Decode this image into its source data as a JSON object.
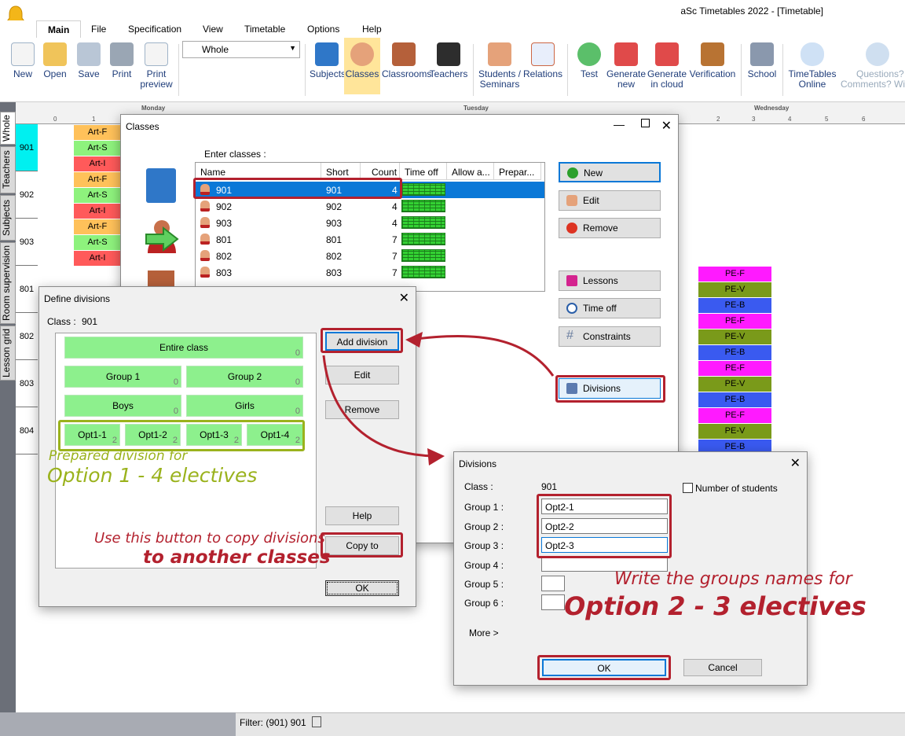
{
  "app": {
    "title": "aSc Timetables 2022  - [Timetable]"
  },
  "tabs": [
    "Main",
    "File",
    "Specification",
    "View",
    "Timetable",
    "Options",
    "Help"
  ],
  "ribbon": {
    "new": "New",
    "open": "Open",
    "save": "Save",
    "print": "Print",
    "print_preview_1": "Print",
    "print_preview_2": "preview",
    "view_combo": "Whole",
    "subjects": "Subjects",
    "classes": "Classes",
    "classrooms": "Classrooms",
    "teachers": "Teachers",
    "students_1": "Students /",
    "students_2": "Seminars",
    "relations": "Relations",
    "test": "Test",
    "gen_new_1": "Generate",
    "gen_new_2": "new",
    "gen_cloud_1": "Generate",
    "gen_cloud_2": "in cloud",
    "verification": "Verification",
    "school": "School",
    "online_1": "TimeTables",
    "online_2": "Online",
    "questions_1": "Questions?",
    "questions_2": "Comments? Wi"
  },
  "side_tabs": [
    "Whole",
    "Teachers",
    "Subjects",
    "Room supervision",
    "Lesson grid"
  ],
  "grid": {
    "days": [
      "Monday",
      "Tuesday",
      "Wednesday"
    ],
    "periods_monday": [
      "0",
      "1"
    ],
    "periods_wed": [
      "2",
      "3",
      "4",
      "5",
      "6"
    ],
    "rows": [
      "901",
      "902",
      "903",
      "801",
      "802",
      "803",
      "804"
    ],
    "art_cells": [
      "Art-F",
      "Art-S",
      "Art-I"
    ],
    "pe_cells": [
      "PE-F",
      "PE-V",
      "PE-B"
    ]
  },
  "classes_dialog": {
    "title": "Classes",
    "enter_label": "Enter classes :",
    "columns": [
      "Name",
      "Short",
      "Count",
      "Time off",
      "Allow a...",
      "Prepar..."
    ],
    "rows": [
      {
        "name": "901",
        "short": "901",
        "count": "4"
      },
      {
        "name": "902",
        "short": "902",
        "count": "4"
      },
      {
        "name": "903",
        "short": "903",
        "count": "4"
      },
      {
        "name": "801",
        "short": "801",
        "count": "7"
      },
      {
        "name": "802",
        "short": "802",
        "count": "7"
      },
      {
        "name": "803",
        "short": "803",
        "count": "7"
      }
    ],
    "buttons": {
      "new": "New",
      "edit": "Edit",
      "remove": "Remove",
      "lessons": "Lessons",
      "time_off": "Time off",
      "constraints": "Constraints",
      "divisions": "Divisions"
    }
  },
  "define_divisions": {
    "title": "Define divisions",
    "class_label": "Class :",
    "class_value": "901",
    "entire": {
      "label": "Entire class",
      "count": "0"
    },
    "groups": [
      {
        "label": "Group 1",
        "count": "0"
      },
      {
        "label": "Group 2",
        "count": "0"
      }
    ],
    "boys_girls": [
      {
        "label": "Boys",
        "count": "0"
      },
      {
        "label": "Girls",
        "count": "0"
      }
    ],
    "options": [
      {
        "label": "Opt1-1",
        "count": "2"
      },
      {
        "label": "Opt1-2",
        "count": "2"
      },
      {
        "label": "Opt1-3",
        "count": "2"
      },
      {
        "label": "Opt1-4",
        "count": "2"
      }
    ],
    "buttons": {
      "add": "Add division",
      "edit": "Edit",
      "remove": "Remove",
      "help": "Help",
      "copy": "Copy to",
      "ok": "OK"
    }
  },
  "divisions_dialog": {
    "title": "Divisions",
    "class_label": "Class :",
    "class_value": "901",
    "num_students": "Number of students",
    "group_labels": [
      "Group 1 :",
      "Group 2 :",
      "Group 3 :",
      "Group 4 :",
      "Group 5 :",
      "Group 6 :"
    ],
    "group_values": [
      "Opt2-1",
      "Opt2-2",
      "Opt2-3",
      "",
      "",
      ""
    ],
    "more": "More >",
    "ok": "OK",
    "cancel": "Cancel"
  },
  "annotations": {
    "prepared_1": "Prepared division for",
    "prepared_2": "Option 1 - 4 electives",
    "copy_1": "Use this button to copy divisions",
    "copy_2": "to another classes",
    "write_1": "Write the groups names for",
    "write_2": "Option 2 - 3 electives"
  },
  "status": {
    "filter": "Filter: (901) 901"
  },
  "colors": {
    "accent_red": "#b3212e",
    "annotation_green": "#9ab21c",
    "selection_blue": "#0a78d7",
    "division_green": "#8df08d"
  }
}
